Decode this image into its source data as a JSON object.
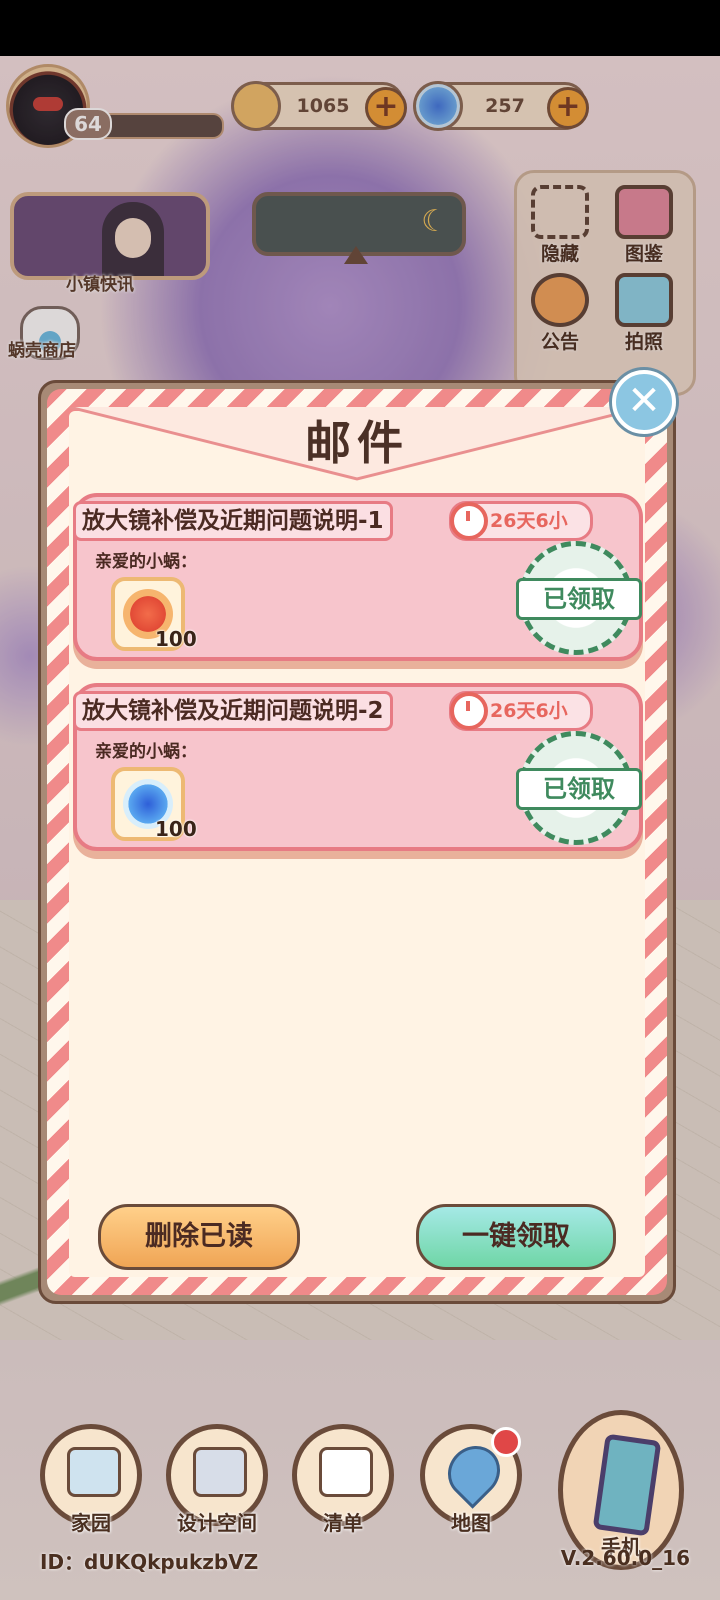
{
  "hud": {
    "level": "64",
    "currency_coin": "1065",
    "currency_shell": "257",
    "news_label": "小镇快讯",
    "shop_label": "蜗壳商店"
  },
  "right_panel": {
    "hide_label": "隐藏",
    "catalog_label": "图鉴",
    "notice_label": "公告",
    "photo_label": "拍照"
  },
  "dialog": {
    "title": "邮件",
    "mails": [
      {
        "title": "放大镜补偿及近期问题说明-1",
        "time_left": "26天6小",
        "greeting": "亲爱的小蜗：",
        "reward_icon": "orange-item-icon",
        "reward_qty": "100",
        "stamp": "已领取"
      },
      {
        "title": "放大镜补偿及近期问题说明-2",
        "time_left": "26天6小",
        "greeting": "亲爱的小蜗：",
        "reward_icon": "blue-shell-icon",
        "reward_qty": "100",
        "stamp": "已领取"
      }
    ],
    "delete_read": "删除已读",
    "claim_all": "一键领取"
  },
  "nav": {
    "home": "家园",
    "design": "设计空间",
    "list": "清单",
    "map": "地图",
    "phone": "手机"
  },
  "footer": {
    "id": "ID：dUKQkpukzbVZ",
    "version": "V.2.60.0_16"
  },
  "colors": {
    "stripe_red": "#f08a8a",
    "mail_pink": "#f7c5cc",
    "stamp_green": "#3f8a5e",
    "claim_teal": "#6fd6a6",
    "delete_orange": "#f0a555"
  }
}
